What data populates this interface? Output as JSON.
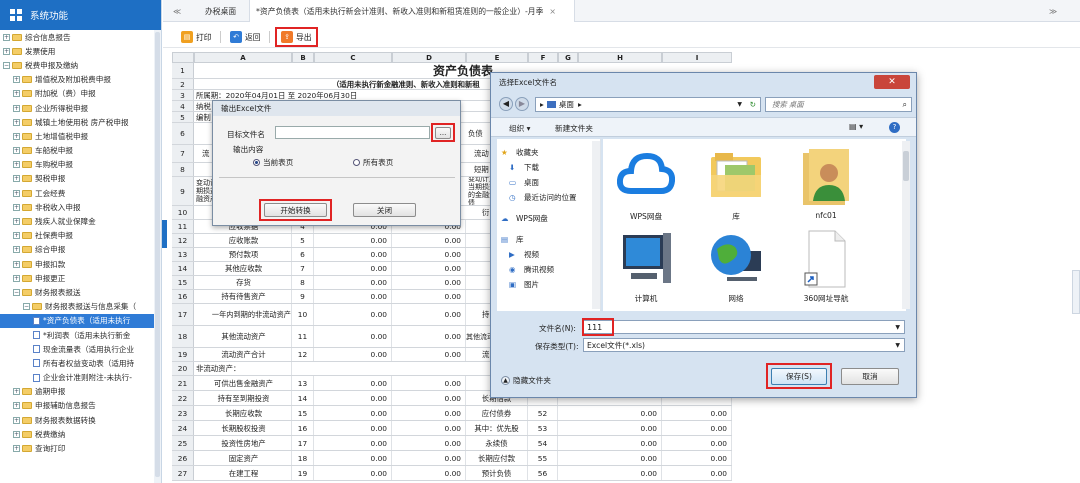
{
  "sidebar": {
    "title": "系统功能",
    "items": [
      {
        "label": "综合信息报告",
        "depth": 0,
        "type": "folder",
        "toggle": "+"
      },
      {
        "label": "发票使用",
        "depth": 0,
        "type": "folder",
        "toggle": "+"
      },
      {
        "label": "税费申报及缴纳",
        "depth": 0,
        "type": "folder",
        "toggle": "−"
      },
      {
        "label": "增值税及附加税费申报",
        "depth": 1,
        "type": "folder",
        "toggle": "+"
      },
      {
        "label": "附加税（费）申报",
        "depth": 1,
        "type": "folder",
        "toggle": "+"
      },
      {
        "label": "企业所得税申报",
        "depth": 1,
        "type": "folder",
        "toggle": "+"
      },
      {
        "label": "城镇土地使用税 房产税申报",
        "depth": 1,
        "type": "folder",
        "toggle": "+"
      },
      {
        "label": "土地增值税申报",
        "depth": 1,
        "type": "folder",
        "toggle": "+"
      },
      {
        "label": "车船税申报",
        "depth": 1,
        "type": "folder",
        "toggle": "+"
      },
      {
        "label": "车购税申报",
        "depth": 1,
        "type": "folder",
        "toggle": "+"
      },
      {
        "label": "契税申报",
        "depth": 1,
        "type": "folder",
        "toggle": "+"
      },
      {
        "label": "工会经费",
        "depth": 1,
        "type": "folder",
        "toggle": "+"
      },
      {
        "label": "非税收入申报",
        "depth": 1,
        "type": "folder",
        "toggle": "+"
      },
      {
        "label": "残疾人就业保障金",
        "depth": 1,
        "type": "folder",
        "toggle": "+"
      },
      {
        "label": "社保费申报",
        "depth": 1,
        "type": "folder",
        "toggle": "+"
      },
      {
        "label": "综合申报",
        "depth": 1,
        "type": "folder",
        "toggle": "+"
      },
      {
        "label": "申报扣款",
        "depth": 1,
        "type": "folder",
        "toggle": "+"
      },
      {
        "label": "申报更正",
        "depth": 1,
        "type": "folder",
        "toggle": "+"
      },
      {
        "label": "财务报表报送",
        "depth": 1,
        "type": "folder",
        "toggle": "−"
      },
      {
        "label": "财务报表报送与信息采集（",
        "depth": 2,
        "type": "folder",
        "toggle": "−"
      },
      {
        "label": "*资产负债表（适用未执行",
        "depth": 3,
        "type": "doc",
        "selected": true
      },
      {
        "label": "*利润表（适用未执行新金",
        "depth": 3,
        "type": "doc"
      },
      {
        "label": "现金流量表（适用执行企业",
        "depth": 3,
        "type": "doc"
      },
      {
        "label": "所有者权益变动表（适用持",
        "depth": 3,
        "type": "doc"
      },
      {
        "label": "企业会计准则附注-未执行-",
        "depth": 3,
        "type": "doc"
      },
      {
        "label": "逾期申报",
        "depth": 1,
        "type": "folder",
        "toggle": "+"
      },
      {
        "label": "申报辅助信息报告",
        "depth": 1,
        "type": "folder",
        "toggle": "+"
      },
      {
        "label": "财务报表数据转换",
        "depth": 1,
        "type": "folder",
        "toggle": "+"
      },
      {
        "label": "税费缴纳",
        "depth": 1,
        "type": "folder",
        "toggle": "+"
      },
      {
        "label": "查询打印",
        "depth": 1,
        "type": "folder",
        "toggle": "+"
      }
    ]
  },
  "tabs": {
    "collapse": "≪",
    "home": "办税桌面",
    "active": "*资产负债表（适用未执行新会计准则、新收入准则和新租赁准则的一般企业）-月季",
    "close": "×",
    "more": "≫"
  },
  "toolbar": {
    "print": "打印",
    "back": "返回",
    "export": "导出"
  },
  "sheet": {
    "columns": [
      "A",
      "B",
      "C",
      "D",
      "E",
      "F",
      "G",
      "H",
      "I"
    ],
    "title": "资产负债表",
    "subtitle": "（适用未执行新金融准则、新收入准则和新租",
    "period": "所属期：2020年04月01日 至 2020年06月30日",
    "r4": "纳税",
    "r5": "编制",
    "r6e": "负债",
    "r7a": "流",
    "r7e": "流动",
    "r8e": "短期",
    "r9a": "变动计入当期损益的金融资产",
    "r9e": "变动计入当期损益的金融负债",
    "r10e": "衍",
    "rows": [
      {
        "n": "11",
        "a": "应收票据",
        "b": "4",
        "c": "0.00",
        "d": "0.00",
        "e": "应"
      },
      {
        "n": "12",
        "a": "应收账款",
        "b": "5",
        "c": "0.00",
        "d": "0.00",
        "e": "应"
      },
      {
        "n": "13",
        "a": "预付款项",
        "b": "6",
        "c": "0.00",
        "d": "0.00",
        "e": "预"
      },
      {
        "n": "14",
        "a": "其他应收款",
        "b": "7",
        "c": "0.00",
        "d": "0.00",
        "e": "应"
      },
      {
        "n": "15",
        "a": "存货",
        "b": "8",
        "c": "0.00",
        "d": "0.00",
        "e": "应"
      },
      {
        "n": "16",
        "a": "持有待售资产",
        "b": "9",
        "c": "0.00",
        "d": "0.00",
        "e": "其"
      }
    ],
    "r17": {
      "n": "17",
      "a": "一年内到期的非流动资产",
      "b": "10",
      "c": "0.00",
      "d": "0.00",
      "e": "持"
    },
    "r18": {
      "n": "18",
      "a": "其他流动资产",
      "b": "11",
      "c": "0.00",
      "d": "0.00",
      "e": "其他流动负债"
    },
    "r19": {
      "n": "19",
      "a": "流动资产合计",
      "b": "12",
      "c": "0.00",
      "d": "0.00",
      "e": "流"
    },
    "r20": {
      "n": "20",
      "a": "非流动资产："
    },
    "tail": [
      {
        "n": "21",
        "a": "可供出售金融资产",
        "b": "13",
        "c": "0.00",
        "d": "0.00",
        "e": "非",
        "f": "",
        "h": "",
        "i": ""
      },
      {
        "n": "22",
        "a": "持有至到期投资",
        "b": "14",
        "c": "0.00",
        "d": "0.00",
        "e": "长期借款",
        "f": "",
        "h": "",
        "i": ""
      },
      {
        "n": "23",
        "a": "长期应收款",
        "b": "15",
        "c": "0.00",
        "d": "0.00",
        "e": "应付债券",
        "f": "52",
        "h": "0.00",
        "i": "0.00"
      },
      {
        "n": "24",
        "a": "长期股权投资",
        "b": "16",
        "c": "0.00",
        "d": "0.00",
        "e": "其中：优先股",
        "f": "53",
        "h": "0.00",
        "i": "0.00"
      },
      {
        "n": "25",
        "a": "投资性房地产",
        "b": "17",
        "c": "0.00",
        "d": "0.00",
        "e": "永续债",
        "f": "54",
        "h": "0.00",
        "i": "0.00"
      },
      {
        "n": "26",
        "a": "固定资产",
        "b": "18",
        "c": "0.00",
        "d": "0.00",
        "e": "长期应付款",
        "f": "55",
        "h": "0.00",
        "i": "0.00"
      },
      {
        "n": "27",
        "a": "在建工程",
        "b": "19",
        "c": "0.00",
        "d": "0.00",
        "e": "预计负债",
        "f": "56",
        "h": "0.00",
        "i": "0.00"
      }
    ]
  },
  "export_dialog": {
    "title": "输出Excel文件",
    "target_label": "目标文件名",
    "target_value": "",
    "browse": "...",
    "output_label": "输出内容",
    "opt_current": "当前表页",
    "opt_all": "所有表页",
    "start": "开始转换",
    "close": "关闭"
  },
  "save_dialog": {
    "title": "选择Excel文件名",
    "close": "✕",
    "path_sep": "▸",
    "path": "桌面",
    "path_arrow": "▸",
    "search_placeholder": "搜索 桌面",
    "organize": "组织 ▾",
    "new_folder": "新建文件夹",
    "nav": [
      {
        "label": "收藏夹",
        "icon": "★"
      },
      {
        "label": "下载",
        "icon": "⬇"
      },
      {
        "label": "桌面",
        "icon": "▭"
      },
      {
        "label": "最近访问的位置",
        "icon": "◷"
      },
      {
        "label": "WPS网盘",
        "icon": "☁"
      },
      {
        "label": "库",
        "icon": "▤"
      },
      {
        "label": "视频",
        "icon": "▶"
      },
      {
        "label": "腾讯视频",
        "icon": "◉"
      },
      {
        "label": "图片",
        "icon": "▣"
      }
    ],
    "files": [
      "WPS网盘",
      "库",
      "nfc01",
      "计算机",
      "网络",
      "360网址导航"
    ],
    "filename_label": "文件名(N):",
    "filename_value": "111",
    "type_label": "保存类型(T):",
    "type_value": "Excel文件(*.xls)",
    "hide_folders": "隐藏文件夹",
    "save": "保存(S)",
    "cancel": "取消"
  }
}
